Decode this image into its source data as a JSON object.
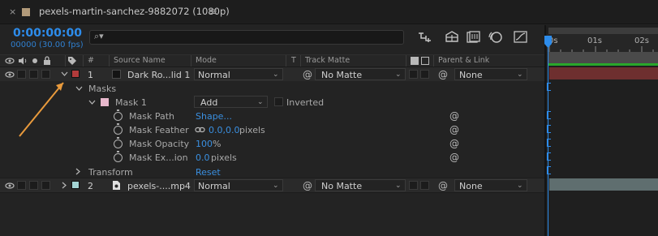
{
  "tab": {
    "close": "×",
    "title": "pexels-martin-sanchez-9882072 (1080p)",
    "menu": "≡"
  },
  "header": {
    "timecode": "0:00:00:00",
    "frames": "00000 (30.00 fps)",
    "search_icon": "⌕▾"
  },
  "columns": {
    "hash": "#",
    "source_name": "Source Name",
    "mode": "Mode",
    "t": "T",
    "track_matte": "Track Matte",
    "parent_link": "Parent & Link"
  },
  "layer1": {
    "number": "1",
    "name": "Dark Ro...lid 1",
    "color": "#b23b3b",
    "mode": "Normal",
    "track_matte": "No Matte",
    "parent": "None"
  },
  "masks": {
    "group_label": "Masks",
    "mask1": {
      "name": "Mask 1",
      "color": "#e8b8cc",
      "mode": "Add",
      "inverted_label": "Inverted",
      "properties": [
        {
          "name": "Mask Path",
          "value": "Shape...",
          "unit": ""
        },
        {
          "name": "Mask Feather",
          "value": "0.0,0.0",
          "unit": "pixels"
        },
        {
          "name": "Mask Opacity",
          "value": "100",
          "unit": "%"
        },
        {
          "name": "Mask Ex...ion",
          "value": "0.0",
          "unit": "pixels"
        }
      ]
    }
  },
  "transform": {
    "label": "Transform",
    "reset": "Reset"
  },
  "layer2": {
    "number": "2",
    "name": "pexels-....mp4",
    "color": "#a4d4d4",
    "mode": "Normal",
    "track_matte": "No Matte",
    "parent": "None"
  },
  "ruler": {
    "t0": "0s",
    "t1": "01s",
    "t2": "02s"
  },
  "colors": {
    "accent_blue": "#2d8ceb",
    "annotation_arrow": "#e89a3c",
    "work_area_green": "#29a72b"
  }
}
